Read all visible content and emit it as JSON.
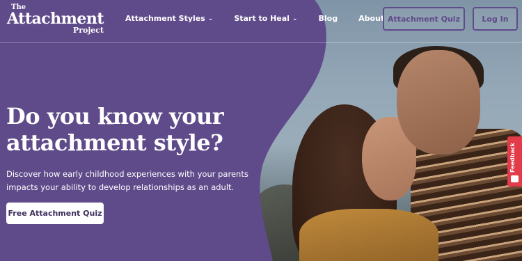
{
  "logo": {
    "line1": "The",
    "line2": "Attachment",
    "line3": "Project"
  },
  "nav": [
    {
      "label": "Attachment Styles",
      "has_dropdown": true
    },
    {
      "label": "Start to Heal",
      "has_dropdown": true
    },
    {
      "label": "Blog",
      "has_dropdown": false
    },
    {
      "label": "About",
      "has_dropdown": false
    }
  ],
  "header_buttons": {
    "quiz": "Attachment Quiz",
    "login": "Log In"
  },
  "hero": {
    "title_line1": "Do you know your",
    "title_line2": "attachment style?",
    "subtitle_line1": "Discover how early childhood experiences with your parents",
    "subtitle_line2": "impacts your ability to develop relationships as an adult.",
    "cta": "Free Attachment Quiz"
  },
  "feedback": {
    "label": "Feedback",
    "icon": "feedback-icon"
  },
  "colors": {
    "brand_purple": "#5f4a8a",
    "feedback_red": "#e23b4a",
    "text_white": "#ffffff"
  }
}
